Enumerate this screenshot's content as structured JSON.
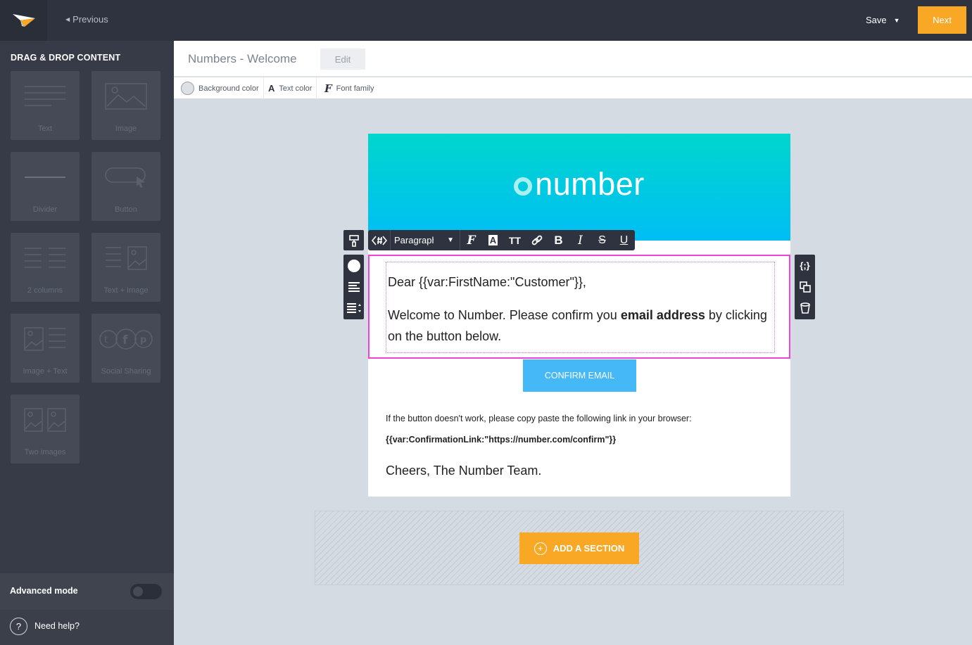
{
  "topbar": {
    "prev_label": "Previous",
    "save_label": "Save",
    "next_label": "Next"
  },
  "sidebar": {
    "title": "DRAG & DROP CONTENT",
    "tiles": [
      {
        "label": "Text",
        "icon": "text-block-icon"
      },
      {
        "label": "Image",
        "icon": "image-icon"
      },
      {
        "label": "Divider",
        "icon": "divider-icon"
      },
      {
        "label": "Button",
        "icon": "button-cursor-icon"
      },
      {
        "label": "2 columns",
        "icon": "two-columns-icon"
      },
      {
        "label": "Text + Image",
        "icon": "text-image-icon"
      },
      {
        "label": "Image + Text",
        "icon": "image-text-icon"
      },
      {
        "label": "Social Sharing",
        "icon": "social-icons"
      },
      {
        "label": "Two images",
        "icon": "two-images-icon"
      }
    ],
    "advanced_label": "Advanced mode",
    "advanced_enabled": false,
    "help_label": "Need help?"
  },
  "header": {
    "title": "Numbers  -  Welcome",
    "edit_label": "Edit"
  },
  "format_bar": {
    "background_color": "Background color",
    "text_color": "Text color",
    "font_family": "Font family"
  },
  "editor_toolbar": {
    "paragraph_label": "Paragraph"
  },
  "email": {
    "brand": "number",
    "greeting": "Dear {{var:FirstName:\"Customer\"}},",
    "body_before": "Welcome to Number. Please confirm you ",
    "body_bold": "email address",
    "body_after": " by clicking on the button below.",
    "cta": "CONFIRM EMAIL",
    "note": "If the button doesn't work, please copy paste the following link in your browser:",
    "link": "{{var:ConfirmationLink:\"https://number.com/confirm\"}}",
    "signoff": "Cheers, The Number Team."
  },
  "add_section": {
    "label": "ADD A SECTION"
  },
  "colors": {
    "accent": "#f9a825",
    "cta": "#45b8f7",
    "selection": "#ee44dd",
    "sidebar_bg": "#373b47"
  }
}
